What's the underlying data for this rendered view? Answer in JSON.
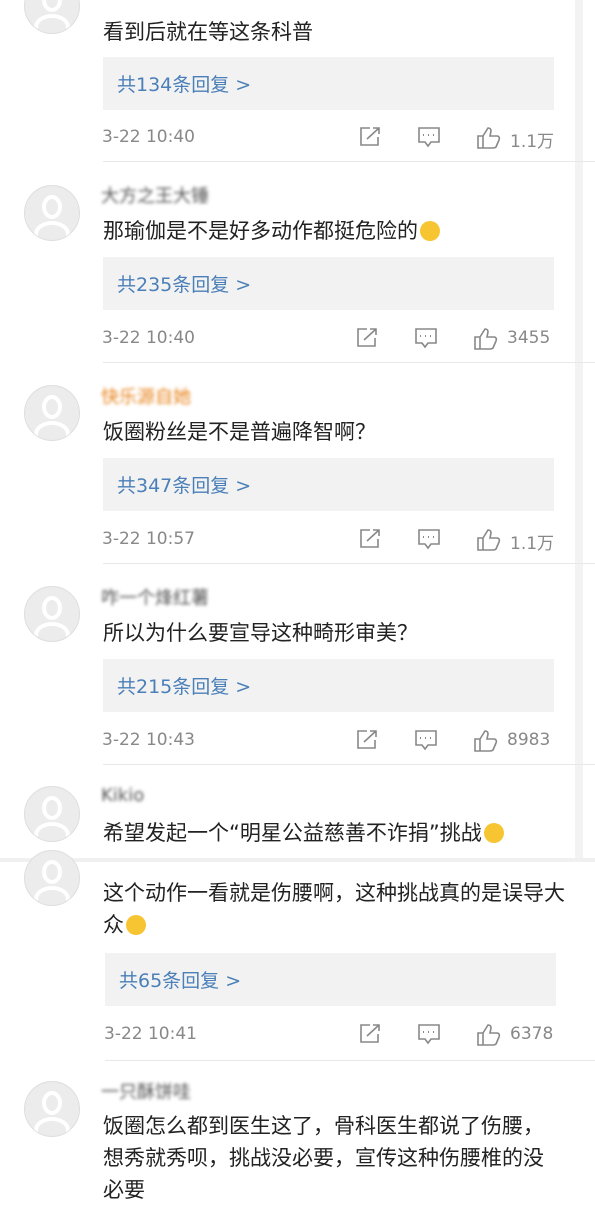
{
  "comments": [
    {
      "user": "",
      "text": "看到后就在等这条科普",
      "replies": "共134条回复 >",
      "time": "3-22 10:40",
      "likes": "1.1万"
    },
    {
      "user": "大方之王大锤",
      "text": "那瑜伽是不是好多动作都挺危险的",
      "emoji": "laughing-tears-emoji",
      "replies": "共235条回复 >",
      "time": "3-22 10:40",
      "likes": "3455"
    },
    {
      "user": "快乐源自她",
      "text": "饭圈粉丝是不是普遍降智啊？",
      "replies": "共347条回复 >",
      "time": "3-22 10:57",
      "likes": "1.1万"
    },
    {
      "user": "咋一个烽红薯",
      "text": "所以为什么要宣导这种畸形审美？",
      "replies": "共215条回复 >",
      "time": "3-22 10:43",
      "likes": "8983"
    },
    {
      "user": "Kikio",
      "text": "希望发起一个“明星公益慈善不诈捐”挑战",
      "emoji": "smile-emoji"
    },
    {
      "user": "",
      "text": "这个动作一看就是伤腰啊，这种挑战真的是误导大众",
      "emoji": "grin-emoji",
      "replies": "共65条回复 >",
      "time": "3-22 10:41",
      "likes": "6378"
    },
    {
      "user": "一只酥饼哇",
      "text": "饭圈怎么都到医生这了，骨科医生都说了伤腰，想秀就秀呗，挑战没必要，宣传这种伤腰椎的没必要"
    }
  ],
  "colors": {
    "reply_link": "#4a7fb8",
    "username_highlight": "#e8821a",
    "reply_bg": "#f2f2f2"
  },
  "icons": [
    "share-icon",
    "comment-icon",
    "like-icon"
  ]
}
